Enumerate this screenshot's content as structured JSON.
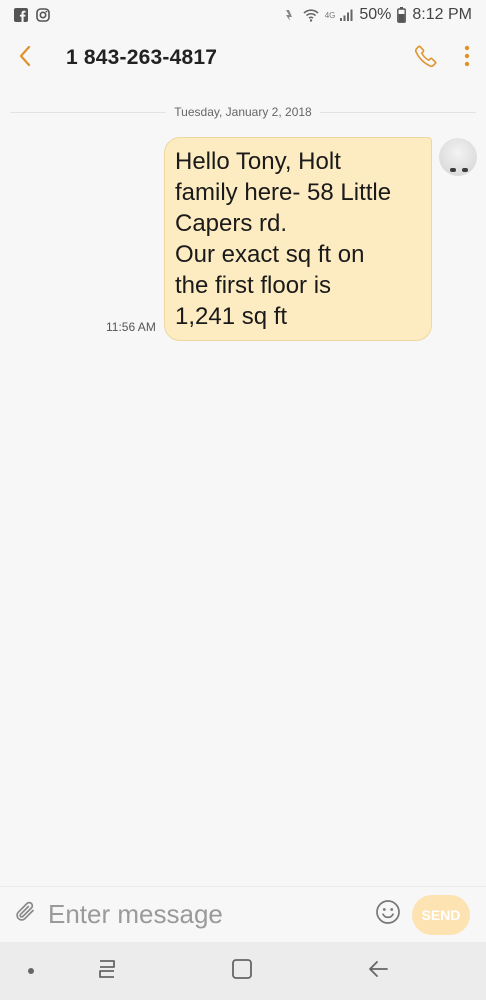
{
  "status_bar": {
    "battery": "50%",
    "time": "8:12 PM",
    "network": "4G",
    "icons": [
      "facebook-icon",
      "instagram-icon",
      "data-saver-icon",
      "wifi-icon",
      "signal-icon",
      "battery-icon"
    ]
  },
  "header": {
    "contact": "1 843-263-4817",
    "icons": [
      "back-arrow-icon",
      "phone-icon",
      "more-vert-icon"
    ],
    "accent_color": "#e0932b"
  },
  "conversation": {
    "date": "Tuesday, January 2, 2018",
    "messages": [
      {
        "time": "11:56 AM",
        "lines": [
          "Hello Tony, Holt",
          "family here- 58 Little",
          "Capers rd.",
          "Our exact sq ft on",
          "the first floor is",
          "1,241 sq ft"
        ],
        "bubble_color": "#fdecc2"
      }
    ]
  },
  "composer": {
    "placeholder": "Enter message",
    "send_label": "SEND",
    "icons": [
      "paperclip-icon",
      "emoji-icon"
    ]
  },
  "nav_bar": {
    "icons": [
      "dot-icon",
      "recent-apps-icon",
      "home-icon",
      "back-icon"
    ]
  }
}
